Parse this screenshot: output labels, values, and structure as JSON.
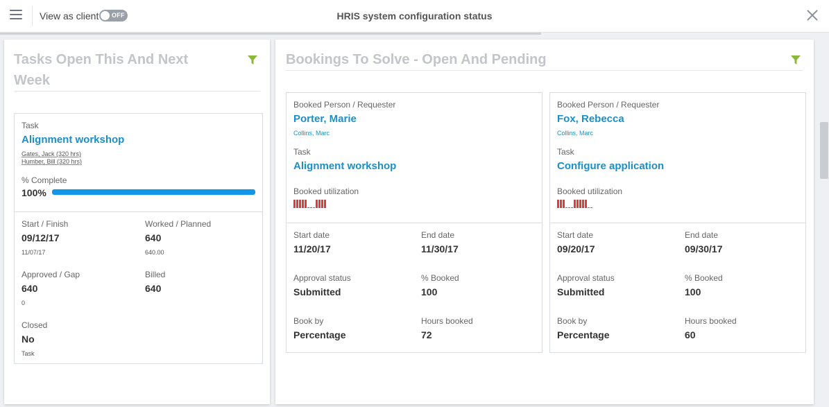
{
  "header": {
    "view_as_client_label": "View as client",
    "toggle_state": "OFF",
    "title": "HRIS system configuration status"
  },
  "colors": {
    "accent_link": "#1a8fc8",
    "filter_icon": "#8cb83a",
    "progress_fill": "#1296e8",
    "utilization_bar": "#e23a3a"
  },
  "icons": {
    "menu": "hamburger-icon",
    "close": "close-icon",
    "filter": "funnel-filter-icon"
  },
  "tasks_panel": {
    "title_line1": "Tasks Open This And Next",
    "title_line2": "Week",
    "card": {
      "task_label": "Task",
      "task_name": "Alignment workshop",
      "assignees": [
        "Gates, Jack (320 hrs)",
        "Humber, Bill (320 hrs)"
      ],
      "complete_label": "% Complete",
      "complete_value": "100%",
      "complete_fraction": 1.0,
      "start_finish_label": "Start / Finish",
      "start_value": "09/12/17",
      "finish_value": "11/07/17",
      "worked_planned_label": "Worked / Planned",
      "worked_value": "640",
      "planned_value": "640.00",
      "approved_gap_label": "Approved / Gap",
      "approved_value": "640",
      "gap_value": "0",
      "billed_label": "Billed",
      "billed_value": "640",
      "closed_label": "Closed",
      "closed_value": "No",
      "closed_sub": "Task"
    }
  },
  "bookings_panel": {
    "title": "Bookings To Solve - Open And Pending",
    "cards": [
      {
        "person_label": "Booked Person / Requester",
        "person_name": "Porter, Marie",
        "requester": "Collins, Marc",
        "task_label": "Task",
        "task_name": "Alignment workshop",
        "utilization_label": "Booked utilization",
        "utilization": [
          1,
          1,
          1,
          1,
          1,
          0,
          0,
          0,
          1,
          1,
          1,
          1
        ],
        "start_label": "Start date",
        "start_value": "11/20/17",
        "end_label": "End date",
        "end_value": "11/30/17",
        "approval_label": "Approval status",
        "approval_value": "Submitted",
        "booked_pct_label": "% Booked",
        "booked_pct_value": "100",
        "bookby_label": "Book by",
        "bookby_value": "Percentage",
        "hours_label": "Hours booked",
        "hours_value": "72"
      },
      {
        "person_label": "Booked Person / Requester",
        "person_name": "Fox, Rebecca",
        "requester": "Collins, Marc",
        "task_label": "Task",
        "task_name": "Configure application",
        "utilization_label": "Booked utilization",
        "utilization": [
          1,
          1,
          1,
          0,
          0,
          0,
          1,
          1,
          1,
          1,
          1,
          0,
          0
        ],
        "start_label": "Start date",
        "start_value": "09/20/17",
        "end_label": "End date",
        "end_value": "09/30/17",
        "approval_label": "Approval status",
        "approval_value": "Submitted",
        "booked_pct_label": "% Booked",
        "booked_pct_value": "100",
        "bookby_label": "Book by",
        "bookby_value": "Percentage",
        "hours_label": "Hours booked",
        "hours_value": "60"
      }
    ]
  }
}
